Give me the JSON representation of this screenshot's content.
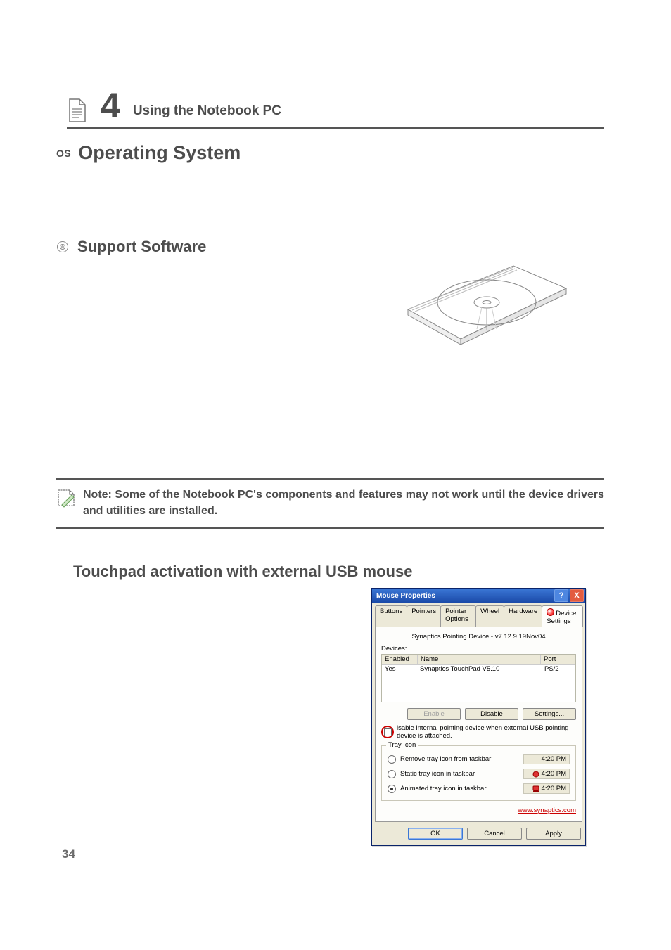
{
  "chapter": {
    "number": "4",
    "title": "Using the Notebook PC"
  },
  "os_tag": "OS",
  "heading_main": "Operating System",
  "heading_support": "Support Software",
  "note_text": "Note: Some of the Notebook PC's components and features may not work until the device drivers and utilities are installed.",
  "heading_touchpad": "Touchpad activation with external USB mouse",
  "page_number": "34",
  "dialog": {
    "title": "Mouse Properties",
    "help_symbol": "?",
    "close_symbol": "X",
    "tabs": {
      "buttons": "Buttons",
      "pointers": "Pointers",
      "pointer_options": "Pointer Options",
      "wheel": "Wheel",
      "hardware": "Hardware",
      "device_settings": "Device Settings"
    },
    "driver_line": "Synaptics Pointing Device - v7.12.9 19Nov04",
    "devices_label": "Devices:",
    "table": {
      "headers": {
        "enabled": "Enabled",
        "name": "Name",
        "port": "Port"
      },
      "row": {
        "enabled": "Yes",
        "name": "Synaptics TouchPad V5.10",
        "port": "PS/2"
      }
    },
    "buttons": {
      "enable": "Enable",
      "disable": "Disable",
      "settings": "Settings...",
      "ok": "OK",
      "cancel": "Cancel",
      "apply": "Apply"
    },
    "disable_checkbox_label": "isable internal pointing device when external USB pointing device is attached.",
    "tray_group": {
      "legend": "Tray Icon",
      "remove": "Remove tray icon from taskbar",
      "static": "Static tray icon in taskbar",
      "animated": "Animated tray icon in taskbar",
      "time1": "4:20 PM",
      "time2": "4:20 PM",
      "time3": "4:20 PM"
    },
    "link": "www.synaptics.com"
  }
}
